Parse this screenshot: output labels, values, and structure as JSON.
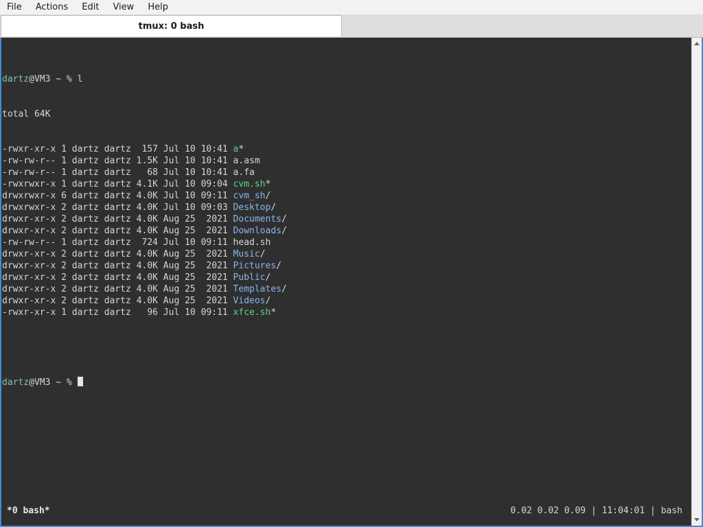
{
  "menu": {
    "items": [
      "File",
      "Actions",
      "Edit",
      "View",
      "Help"
    ]
  },
  "tab": {
    "title": "tmux: 0 bash"
  },
  "terminal": {
    "prompt": {
      "user": "dartz",
      "at": "@",
      "host": "VM3",
      "suffix": " ~ % "
    },
    "command": "l",
    "total": "total 64K",
    "entries": [
      {
        "meta": "-rwxr-xr-x 1 dartz dartz  157 Jul 10 10:41 ",
        "name": "a",
        "suffix": "*",
        "kind": "exec"
      },
      {
        "meta": "-rw-rw-r-- 1 dartz dartz 1.5K Jul 10 10:41 ",
        "name": "a.asm",
        "suffix": "",
        "kind": "file"
      },
      {
        "meta": "-rw-rw-r-- 1 dartz dartz   68 Jul 10 10:41 ",
        "name": "a.fa",
        "suffix": "",
        "kind": "file"
      },
      {
        "meta": "-rwxrwxr-x 1 dartz dartz 4.1K Jul 10 09:04 ",
        "name": "cvm.sh",
        "suffix": "*",
        "kind": "exec"
      },
      {
        "meta": "drwxrwxr-x 6 dartz dartz 4.0K Jul 10 09:11 ",
        "name": "cvm_sh",
        "suffix": "/",
        "kind": "dir"
      },
      {
        "meta": "drwxrwxr-x 2 dartz dartz 4.0K Jul 10 09:03 ",
        "name": "Desktop",
        "suffix": "/",
        "kind": "dir"
      },
      {
        "meta": "drwxr-xr-x 2 dartz dartz 4.0K Aug 25  2021 ",
        "name": "Documents",
        "suffix": "/",
        "kind": "dir"
      },
      {
        "meta": "drwxr-xr-x 2 dartz dartz 4.0K Aug 25  2021 ",
        "name": "Downloads",
        "suffix": "/",
        "kind": "dir"
      },
      {
        "meta": "-rw-rw-r-- 1 dartz dartz  724 Jul 10 09:11 ",
        "name": "head.sh",
        "suffix": "",
        "kind": "file"
      },
      {
        "meta": "drwxr-xr-x 2 dartz dartz 4.0K Aug 25  2021 ",
        "name": "Music",
        "suffix": "/",
        "kind": "dir"
      },
      {
        "meta": "drwxr-xr-x 2 dartz dartz 4.0K Aug 25  2021 ",
        "name": "Pictures",
        "suffix": "/",
        "kind": "dir"
      },
      {
        "meta": "drwxr-xr-x 2 dartz dartz 4.0K Aug 25  2021 ",
        "name": "Public",
        "suffix": "/",
        "kind": "dir"
      },
      {
        "meta": "drwxr-xr-x 2 dartz dartz 4.0K Aug 25  2021 ",
        "name": "Templates",
        "suffix": "/",
        "kind": "dir"
      },
      {
        "meta": "drwxr-xr-x 2 dartz dartz 4.0K Aug 25  2021 ",
        "name": "Videos",
        "suffix": "/",
        "kind": "dir"
      },
      {
        "meta": "-rwxr-xr-x 1 dartz dartz   96 Jul 10 09:11 ",
        "name": "xfce.sh",
        "suffix": "*",
        "kind": "exec"
      }
    ]
  },
  "status": {
    "left": "*0 bash*",
    "right": "0.02 0.02 0.09 | 11:04:01 | bash"
  },
  "colors": {
    "accent": "#3f8dd6",
    "prompt_user": "#7fc0b2",
    "exec": "#5fd38a",
    "dir": "#8ab4f0",
    "background": "#2f2f2f"
  }
}
